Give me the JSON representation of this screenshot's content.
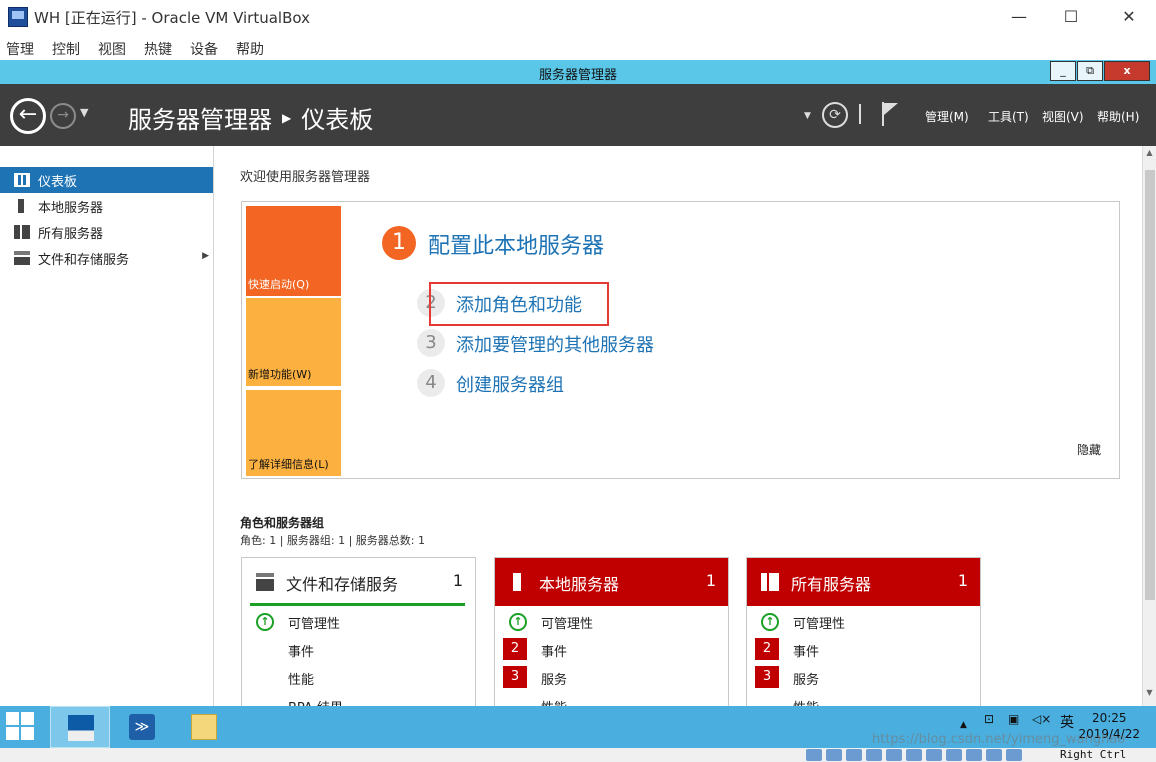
{
  "vbox": {
    "title": "WH [正在运行] - Oracle VM VirtualBox",
    "menu": [
      "管理",
      "控制",
      "视图",
      "热键",
      "设备",
      "帮助"
    ],
    "host_key": "Right Ctrl"
  },
  "guest_window": {
    "title": "服务器管理器",
    "controls": [
      "_",
      "⧉",
      "x"
    ]
  },
  "header": {
    "breadcrumb_root": "服务器管理器",
    "breadcrumb_current": "仪表板",
    "menus": [
      "管理(M)",
      "工具(T)",
      "视图(V)",
      "帮助(H)"
    ]
  },
  "sidebar": {
    "items": [
      {
        "label": "仪表板",
        "icon": "dashboard-icon",
        "active": true
      },
      {
        "label": "本地服务器",
        "icon": "server-icon",
        "active": false
      },
      {
        "label": "所有服务器",
        "icon": "servers-icon",
        "active": false
      },
      {
        "label": "文件和存储服务",
        "icon": "storage-icon",
        "active": false
      }
    ]
  },
  "welcome": {
    "title": "欢迎使用服务器管理器",
    "tiles": [
      "快速启动(Q)",
      "新增功能(W)",
      "了解详细信息(L)"
    ],
    "main_step": {
      "number": "1",
      "label": "配置此本地服务器"
    },
    "steps": [
      {
        "number": "2",
        "label": "添加角色和功能"
      },
      {
        "number": "3",
        "label": "添加要管理的其他服务器"
      },
      {
        "number": "4",
        "label": "创建服务器组"
      }
    ],
    "hide_label": "隐藏"
  },
  "roles": {
    "title": "角色和服务器组",
    "summary": "角色: 1 | 服务器组: 1 | 服务器总数: 1",
    "cards": [
      {
        "title": "文件和存储服务",
        "count": "1",
        "rows": [
          {
            "label": "可管理性",
            "status": "ok"
          },
          {
            "label": "事件",
            "badge": ""
          },
          {
            "label": "性能",
            "badge": ""
          },
          {
            "label": "BPA 结果",
            "badge": ""
          }
        ]
      },
      {
        "title": "本地服务器",
        "count": "1",
        "rows": [
          {
            "label": "可管理性",
            "status": "ok"
          },
          {
            "label": "事件",
            "badge": "2"
          },
          {
            "label": "服务",
            "badge": "3"
          },
          {
            "label": "性能",
            "badge": ""
          }
        ]
      },
      {
        "title": "所有服务器",
        "count": "1",
        "rows": [
          {
            "label": "可管理性",
            "status": "ok"
          },
          {
            "label": "事件",
            "badge": "2"
          },
          {
            "label": "服务",
            "badge": "3"
          },
          {
            "label": "性能",
            "badge": ""
          }
        ]
      }
    ]
  },
  "taskbar": {
    "tray_lang": "英",
    "time": "20:25",
    "date": "2019/4/22"
  },
  "watermark": "https://blog.csdn.net/yimeng_wanghao",
  "colors": {
    "accent_blue": "#1e73b5",
    "alert_red": "#c00000",
    "tile_orange": "#f26522",
    "tile_amber": "#fbb040",
    "ok_green": "#1aa125"
  }
}
